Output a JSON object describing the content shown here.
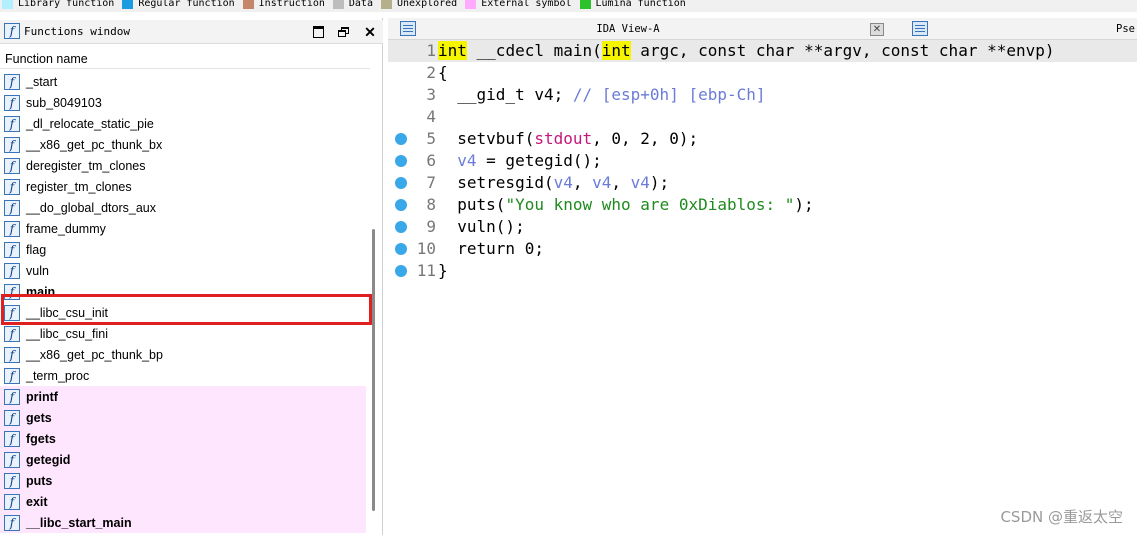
{
  "legend": [
    {
      "label": "Library function",
      "color": "#b3f0ff"
    },
    {
      "label": "Regular function",
      "color": "#1b9be0"
    },
    {
      "label": "Instruction",
      "color": "#c4866a"
    },
    {
      "label": "Data",
      "color": "#bdbdbd"
    },
    {
      "label": "Unexplored",
      "color": "#b5b08a"
    },
    {
      "label": "External symbol",
      "color": "#ffaaff"
    },
    {
      "label": "Lumina function",
      "color": "#2cc22c"
    }
  ],
  "functions_window": {
    "title": "Functions window",
    "column_header": "Function name",
    "items": [
      {
        "name": "_start",
        "type": "regular"
      },
      {
        "name": "sub_8049103",
        "type": "regular"
      },
      {
        "name": "_dl_relocate_static_pie",
        "type": "regular"
      },
      {
        "name": "__x86_get_pc_thunk_bx",
        "type": "regular"
      },
      {
        "name": "deregister_tm_clones",
        "type": "regular"
      },
      {
        "name": "register_tm_clones",
        "type": "regular"
      },
      {
        "name": "__do_global_dtors_aux",
        "type": "regular"
      },
      {
        "name": "frame_dummy",
        "type": "regular"
      },
      {
        "name": "flag",
        "type": "regular"
      },
      {
        "name": "vuln",
        "type": "regular"
      },
      {
        "name": "main",
        "type": "regular",
        "bold": true,
        "highlighted": true
      },
      {
        "name": "__libc_csu_init",
        "type": "regular"
      },
      {
        "name": "__libc_csu_fini",
        "type": "regular"
      },
      {
        "name": "__x86_get_pc_thunk_bp",
        "type": "regular"
      },
      {
        "name": "_term_proc",
        "type": "regular"
      },
      {
        "name": "printf",
        "type": "external"
      },
      {
        "name": "gets",
        "type": "external"
      },
      {
        "name": "fgets",
        "type": "external"
      },
      {
        "name": "getegid",
        "type": "external"
      },
      {
        "name": "puts",
        "type": "external"
      },
      {
        "name": "exit",
        "type": "external"
      },
      {
        "name": "__libc_start_main",
        "type": "external"
      }
    ]
  },
  "ida_view": {
    "tab_title": "IDA View-A",
    "second_tab_title": "Pse",
    "lines": [
      {
        "n": "1",
        "sel": true,
        "dot": false,
        "parts": [
          [
            "int",
            "kwhl"
          ],
          [
            " __cdecl main(",
            ""
          ],
          [
            "int",
            "kwhl"
          ],
          [
            " argc, const char **argv, const char **envp)",
            ""
          ]
        ]
      },
      {
        "n": "2",
        "dot": false,
        "parts": [
          [
            "{",
            ""
          ]
        ]
      },
      {
        "n": "3",
        "dot": false,
        "parts": [
          [
            "  __gid_t v4; ",
            ""
          ],
          [
            "// [esp+0h] [ebp-Ch]",
            "c-cmt"
          ]
        ]
      },
      {
        "n": "4",
        "dot": false,
        "parts": [
          [
            "",
            ""
          ]
        ]
      },
      {
        "n": "5",
        "dot": true,
        "parts": [
          [
            "  setvbuf(",
            ""
          ],
          [
            "stdout",
            "c-glob"
          ],
          [
            ", 0, 2, 0);",
            ""
          ]
        ]
      },
      {
        "n": "6",
        "dot": true,
        "parts": [
          [
            "  ",
            ""
          ],
          [
            "v4",
            "c-var"
          ],
          [
            " = getegid();",
            ""
          ]
        ]
      },
      {
        "n": "7",
        "dot": true,
        "parts": [
          [
            "  setresgid(",
            ""
          ],
          [
            "v4",
            "c-var"
          ],
          [
            ", ",
            ""
          ],
          [
            "v4",
            "c-var"
          ],
          [
            ", ",
            ""
          ],
          [
            "v4",
            "c-var"
          ],
          [
            ");",
            ""
          ]
        ]
      },
      {
        "n": "8",
        "dot": true,
        "parts": [
          [
            "  puts(",
            ""
          ],
          [
            "\"You know who are 0xDiablos: \"",
            "c-str"
          ],
          [
            ");",
            ""
          ]
        ]
      },
      {
        "n": "9",
        "dot": true,
        "parts": [
          [
            "  vuln();",
            ""
          ]
        ]
      },
      {
        "n": "10",
        "dot": true,
        "parts": [
          [
            "  return 0;",
            ""
          ]
        ]
      },
      {
        "n": "11",
        "dot": true,
        "parts": [
          [
            "}",
            ""
          ]
        ]
      }
    ]
  },
  "watermark": "CSDN @重返太空"
}
